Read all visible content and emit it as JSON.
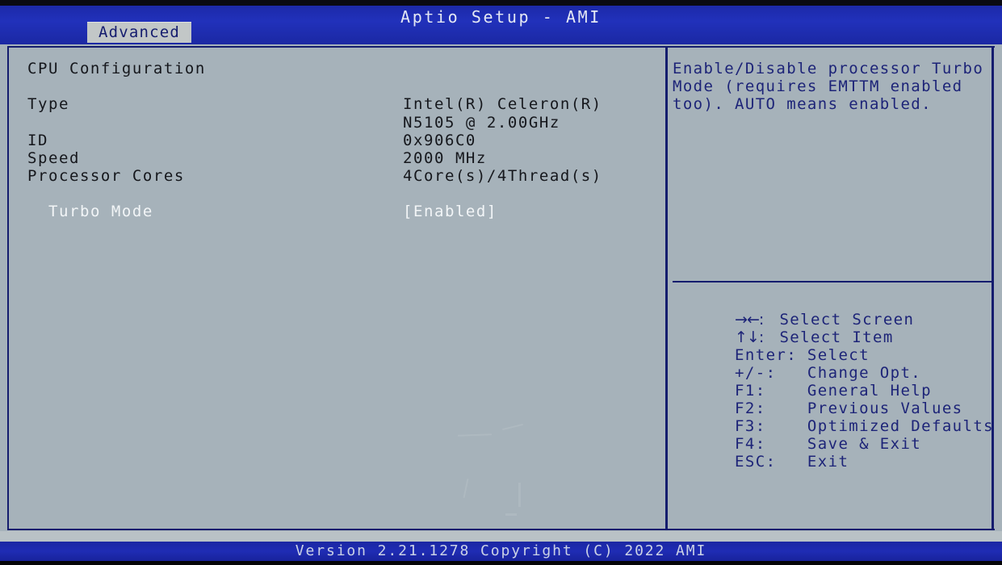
{
  "header": {
    "title": "Aptio Setup - AMI",
    "tab_label": "Advanced"
  },
  "main": {
    "section_title": "CPU Configuration",
    "rows": [
      {
        "label": "Type",
        "value": "Intel(R) Celeron(R)"
      },
      {
        "label": "",
        "value": "N5105 @ 2.00GHz"
      },
      {
        "label": "ID",
        "value": "0x906C0"
      },
      {
        "label": "Speed",
        "value": "2000 MHz"
      },
      {
        "label": "Processor Cores",
        "value": "4Core(s)/4Thread(s)"
      }
    ],
    "setting": {
      "label": "Turbo Mode",
      "value": "[Enabled]",
      "selected": true
    }
  },
  "help": {
    "lines": [
      "Enable/Disable processor Turbo",
      "Mode (requires EMTTM enabled",
      "too). AUTO means enabled."
    ]
  },
  "legend": {
    "items": [
      {
        "key": "→←:",
        "action": "Select Screen"
      },
      {
        "key": "↑↓:",
        "action": "Select Item"
      },
      {
        "key": "Enter:",
        "action": "Select"
      },
      {
        "key": "+/-:",
        "action": "Change Opt."
      },
      {
        "key": "F1:",
        "action": "General Help"
      },
      {
        "key": "F2:",
        "action": "Previous Values"
      },
      {
        "key": "F3:",
        "action": "Optimized Defaults"
      },
      {
        "key": "F4:",
        "action": "Save & Exit"
      },
      {
        "key": "ESC:",
        "action": "Exit"
      }
    ]
  },
  "footer": {
    "version_text": "Version 2.21.1278 Copyright (C) 2022 AMI"
  },
  "colors": {
    "header_blue": "#1f2cb4",
    "panel_bg": "#a6b2ba",
    "border_navy": "#141c6e",
    "text_dark": "#15171c",
    "text_help": "#1d2478",
    "text_selected": "#f2f5f7",
    "tab_bg": "#c2c7c7"
  }
}
